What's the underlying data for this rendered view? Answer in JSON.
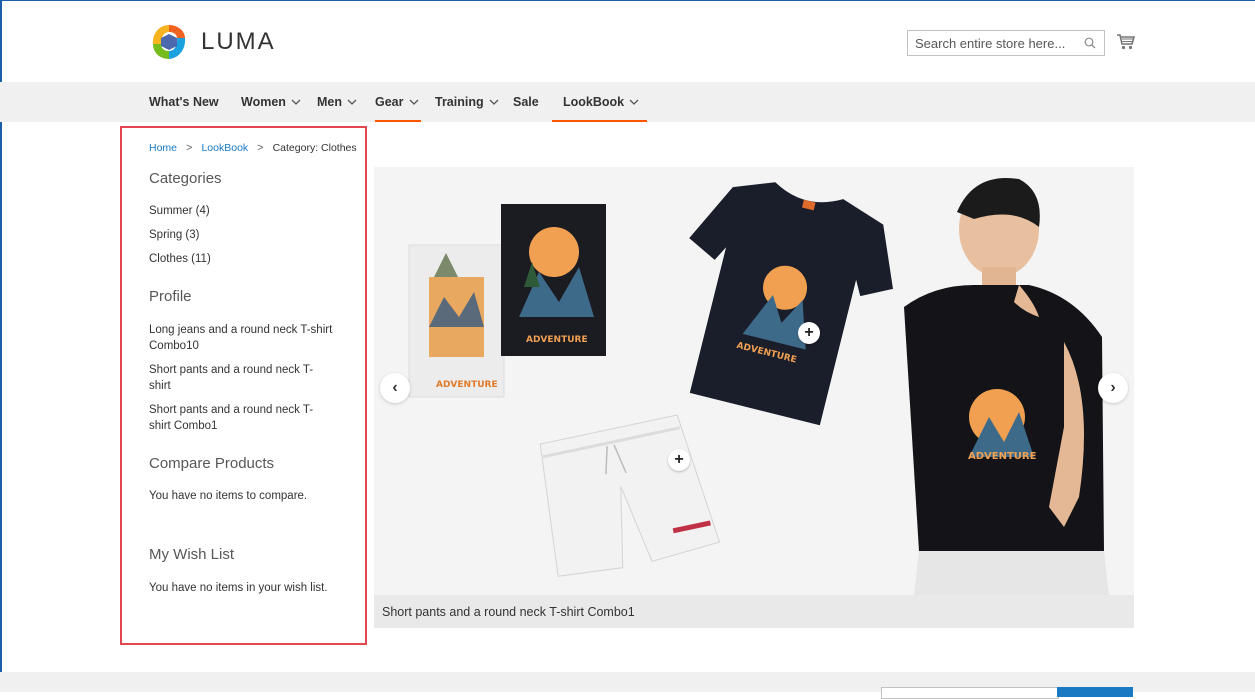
{
  "header": {
    "logo_text": "LUMA",
    "search_placeholder": "Search entire store here...",
    "colors": {
      "accent": "#ff5501",
      "link": "#1979c3"
    }
  },
  "nav": {
    "items": [
      {
        "label": "What's New",
        "has_dropdown": false,
        "active": false
      },
      {
        "label": "Women",
        "has_dropdown": true,
        "active": false
      },
      {
        "label": "Men",
        "has_dropdown": true,
        "active": false
      },
      {
        "label": "Gear",
        "has_dropdown": true,
        "active": true
      },
      {
        "label": "Training",
        "has_dropdown": true,
        "active": false
      },
      {
        "label": "Sale",
        "has_dropdown": false,
        "active": false
      },
      {
        "label": "LookBook",
        "has_dropdown": true,
        "active": true
      }
    ]
  },
  "breadcrumb": {
    "home": "Home",
    "lookbook": "LookBook",
    "current": "Category: Clothes",
    "separator": ">"
  },
  "sidebar": {
    "categories_title": "Categories",
    "categories": [
      "Summer (4)",
      "Spring (3)",
      "Clothes (11)"
    ],
    "profile_title": "Profile",
    "profiles": [
      "Long jeans and a round neck T-shirt Combo10",
      "Short pants and a round neck T-shirt",
      "Short pants and a round neck T-shirt Combo1"
    ],
    "compare_title": "Compare Products",
    "compare_text": "You have no items to compare.",
    "wishlist_title": "My Wish List",
    "wishlist_text": "You have no items in your wish list."
  },
  "banner": {
    "caption": "Short pants and a round neck T-shirt Combo1",
    "print_text": "ADVENTURE",
    "prev": "‹",
    "next": "›",
    "hotspot": "+"
  }
}
